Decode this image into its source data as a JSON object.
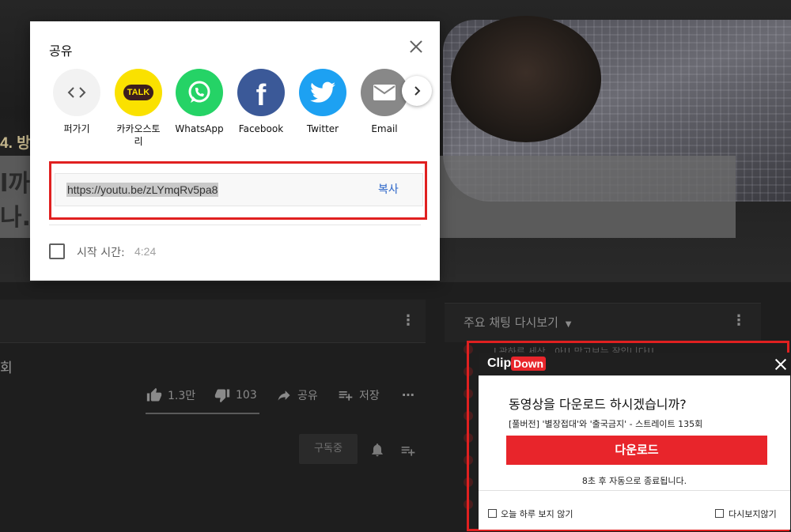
{
  "background_page": {
    "episode_label": "4. 방",
    "title_line1": "l까",
    "title_line2": "나...",
    "views_text": "회",
    "actions": {
      "like_count": "1.3만",
      "dislike_count": "103",
      "share_label": "공유",
      "save_label": "저장"
    },
    "subscribe_label": "구독중",
    "chat_replay_label": "주요 채팅 다시보기",
    "chat_top_line": "L광하루 세상...아!! 맞고보는 잘입니다!!"
  },
  "share_dialog": {
    "title": "공유",
    "options": [
      {
        "label": "퍼가기",
        "icon": "embed-icon",
        "color": "#f2f2f2"
      },
      {
        "label": "카카오스토리",
        "icon": "kakao-talk-icon",
        "color": "#fae100"
      },
      {
        "label": "WhatsApp",
        "icon": "whatsapp-icon",
        "color": "#25d366"
      },
      {
        "label": "Facebook",
        "icon": "facebook-icon",
        "color": "#3b5998"
      },
      {
        "label": "Twitter",
        "icon": "twitter-icon",
        "color": "#1da1f2"
      },
      {
        "label": "Email",
        "icon": "email-icon",
        "color": "#888888"
      }
    ],
    "kakao_badge_text": "TALK",
    "link_url": "https://youtu.be/zLYmqRv5pa8",
    "copy_label": "복사",
    "start_time_label": "시작 시간:",
    "start_time_value": "4:24",
    "highlight_color": "#e02020"
  },
  "clipdown": {
    "logo_clip": "Clip",
    "logo_down": "Down",
    "question": "동영상을 다운로드 하시겠습니까?",
    "video_title": "[풀버전] '별장접대'와 '출국금지' - 스트레이트 135회",
    "download_label": "다운로드",
    "countdown_text": "8초 후 자동으로 종료됩니다.",
    "skip_today_label": "오늘 하루 보지 않기",
    "never_show_label": "다시보지않기",
    "accent_color": "#e8252b"
  }
}
